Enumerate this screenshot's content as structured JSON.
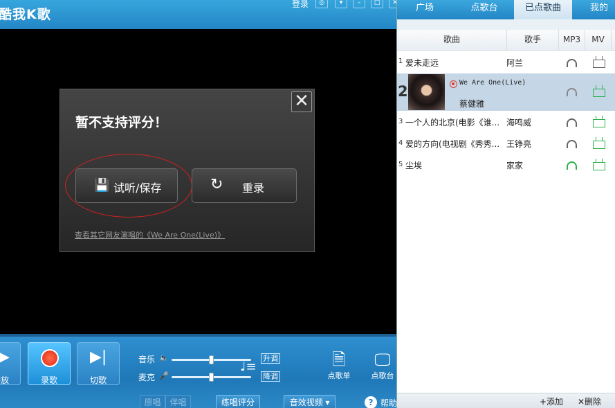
{
  "app": {
    "title": "酷我K歌",
    "login": "登录"
  },
  "dialog": {
    "message": "暂不支持评分！",
    "save_label": "试听/保存",
    "rerecord_label": "重录",
    "link_text": "查看其它网友演唱的《We Are One(Live)》"
  },
  "controls": {
    "play_label": "播放",
    "record_label": "录歌",
    "skip_label": "切歌",
    "music_label": "音乐",
    "mic_label": "麦克",
    "key_up": "升调",
    "key_down": "降调",
    "music_level": 0.5,
    "mic_level": 0.5,
    "songlist_label": "点歌单",
    "booth_label": "点歌台",
    "original_label": "原唱",
    "accompany_label": "伴唱",
    "practice_label": "练唱评分",
    "effects_label": "音效视频",
    "help_label": "帮助"
  },
  "tabs": [
    {
      "label": "广场"
    },
    {
      "label": "点歌台"
    },
    {
      "label": "已点歌曲"
    },
    {
      "label": "我的"
    }
  ],
  "playlist": {
    "headers": {
      "song": "歌曲",
      "singer": "歌手",
      "mp3": "MP3",
      "mv": "MV"
    },
    "rows": [
      {
        "num": "1",
        "title": "爱未走远",
        "singer": "阿兰"
      },
      {
        "num": "2",
        "title": "We Are One(Live)",
        "singer": "蔡健雅"
      },
      {
        "num": "3",
        "title": "一个人的北京(电影《谁...",
        "singer": "海鸣威"
      },
      {
        "num": "4",
        "title": "爱的方向(电视剧《秀秀...",
        "singer": "王铮亮"
      },
      {
        "num": "5",
        "title": "尘埃",
        "singer": "家家"
      }
    ],
    "add_label": "+添加",
    "delete_label": "✕删除"
  }
}
